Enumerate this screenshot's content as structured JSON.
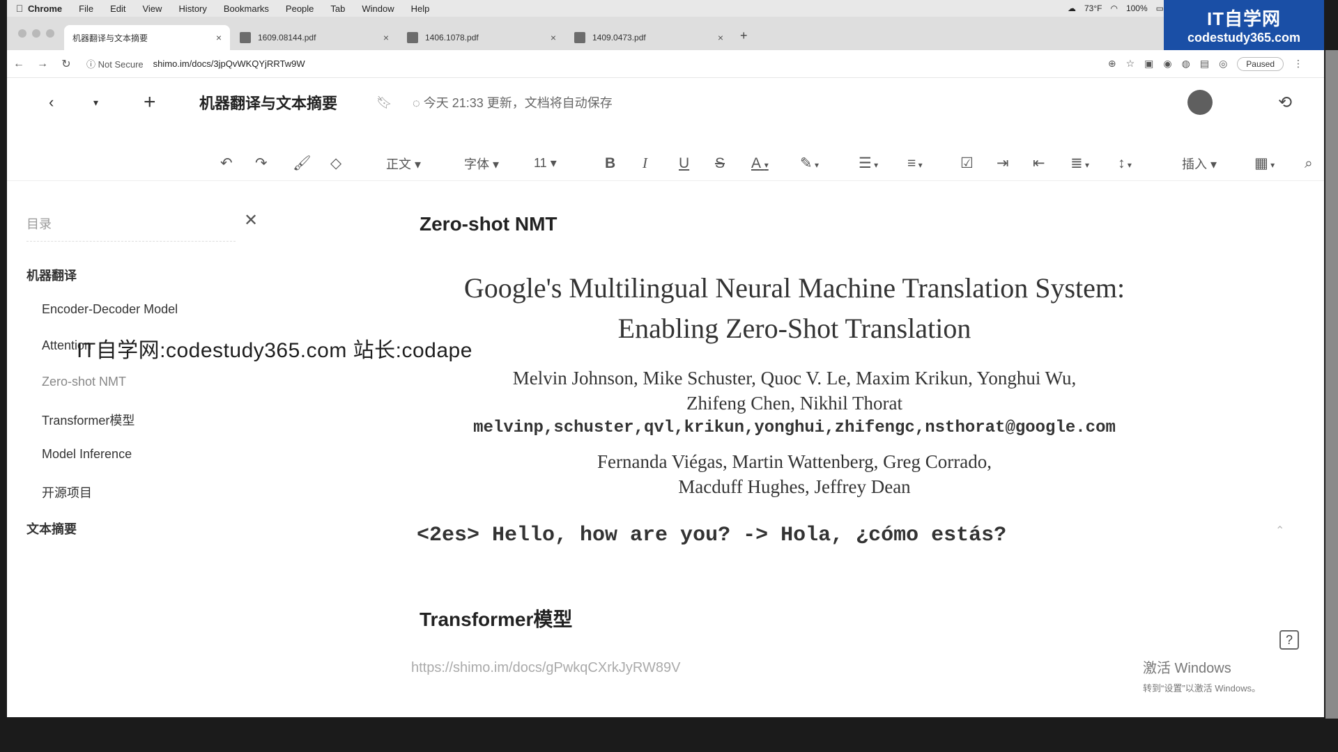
{
  "menubar": {
    "app": "Chrome",
    "items": [
      "File",
      "Edit",
      "View",
      "History",
      "Bookmarks",
      "People",
      "Tab",
      "Window",
      "Help"
    ],
    "status": [
      "73°F",
      "100%"
    ]
  },
  "tabs": [
    {
      "label": "机器翻译与文本摘要",
      "active": true
    },
    {
      "label": "1609.08144.pdf",
      "active": false
    },
    {
      "label": "1406.1078.pdf",
      "active": false
    },
    {
      "label": "1409.0473.pdf",
      "active": false
    }
  ],
  "brand": {
    "line1": "IT自学网",
    "line2": "codestudy365.com"
  },
  "address": {
    "security": "Not Secure",
    "url": "shimo.im/docs/3jpQvWKQYjRRTw9W",
    "paused": "Paused"
  },
  "doc": {
    "title": "机器翻译与文本摘要",
    "save_status": "今天 21:33 更新，文档将自动保存"
  },
  "toolbar": {
    "style": "正文",
    "font": "字体",
    "size": "11",
    "insert": "插入",
    "bold": "B",
    "italic": "I",
    "underline": "U",
    "strike": "S",
    "fontcolor": "A"
  },
  "toc": {
    "title": "目录",
    "items": [
      {
        "label": "机器翻译",
        "level": 1
      },
      {
        "label": "Encoder-Decoder Model",
        "level": 2
      },
      {
        "label": "Attention",
        "level": 2
      },
      {
        "label": "Zero-shot NMT",
        "level": 2
      },
      {
        "label": "Transformer模型",
        "level": 2
      },
      {
        "label": "Model Inference",
        "level": 2
      },
      {
        "label": "开源项目",
        "level": 2
      },
      {
        "label": "文本摘要",
        "level": 1
      }
    ]
  },
  "watermark": "IT自学网:codestudy365.com 站长:codape",
  "content": {
    "heading1": "Zero-shot NMT",
    "paper_title_line1": "Google's Multilingual Neural Machine Translation System:",
    "paper_title_line2": "Enabling Zero-Shot Translation",
    "authors_line1": "Melvin Johnson, Mike Schuster, Quoc V. Le, Maxim Krikun, Yonghui Wu,",
    "authors_line2": "Zhifeng Chen, Nikhil Thorat",
    "emails": "melvinp,schuster,qvl,krikun,yonghui,zhifengc,nsthorat@google.com",
    "authors2_line1": "Fernanda Viégas, Martin Wattenberg, Greg Corrado,",
    "authors2_line2": "Macduff Hughes, Jeffrey Dean",
    "example": "<2es> Hello, how are you? -> Hola, ¿cómo estás?",
    "heading2": "Transformer模型",
    "link": "https://shimo.im/docs/gPwkqCXrkJyRW89V"
  },
  "activate": {
    "line1": "激活 Windows",
    "line2": "转到“设置”以激活 Windows。"
  }
}
